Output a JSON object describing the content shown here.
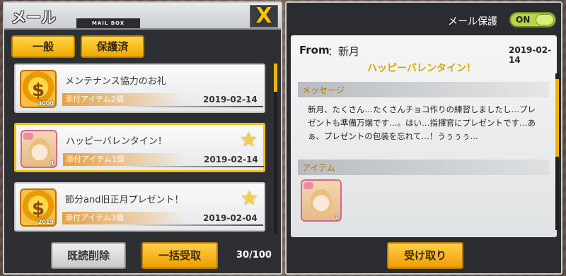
{
  "left_panel": {
    "title": "メール",
    "mailbox_tag": "MAIL BOX",
    "close_glyph": "X",
    "tabs": [
      {
        "label": "一般",
        "active": true
      },
      {
        "label": "保護済",
        "active": false
      }
    ],
    "mails": [
      {
        "title": "メンテナンス協力のお礼",
        "attachment": "添付アイテム2個",
        "date": "2019-02-14",
        "icon": "gold-coin-icon",
        "icon_count": "3000",
        "protected": false,
        "selected": false
      },
      {
        "title": "ハッピーバレンタイン！",
        "attachment": "添付アイテム1個",
        "date": "2019-02-14",
        "icon": "character-portrait-icon",
        "icon_count": "1",
        "protected": true,
        "selected": true
      },
      {
        "title": "節分and旧正月プレゼント！",
        "attachment": "添付アイテム3個",
        "date": "2019-02-04",
        "icon": "gold-coin-icon",
        "icon_count": "2019",
        "protected": true,
        "selected": false
      }
    ],
    "buttons": {
      "delete_read": "既読削除",
      "receive_all": "一括受取"
    },
    "count": "30/100"
  },
  "right_panel": {
    "protect_label": "メール保護",
    "toggle_label": "ON",
    "from_label": "From",
    "from_name": "：新月",
    "date": "2019-02-14",
    "subject": "ハッピーバレンタイン！",
    "message_header": "メッセージ",
    "message_body": "新月、たくさん…たくさんチョコ作りの練習しましたし…プレゼントも準備万端です…。はい…指揮官にプレゼントです…あぁ、プレゼントの包装を忘れて…！うぅぅぅ…",
    "items_header": "アイテム",
    "item_count": "1",
    "receive_button": "受け取り"
  },
  "colors": {
    "accent": "#f3bf1a",
    "toggle_on": "#b5d64a",
    "attachment_bar": "#e8a040"
  }
}
